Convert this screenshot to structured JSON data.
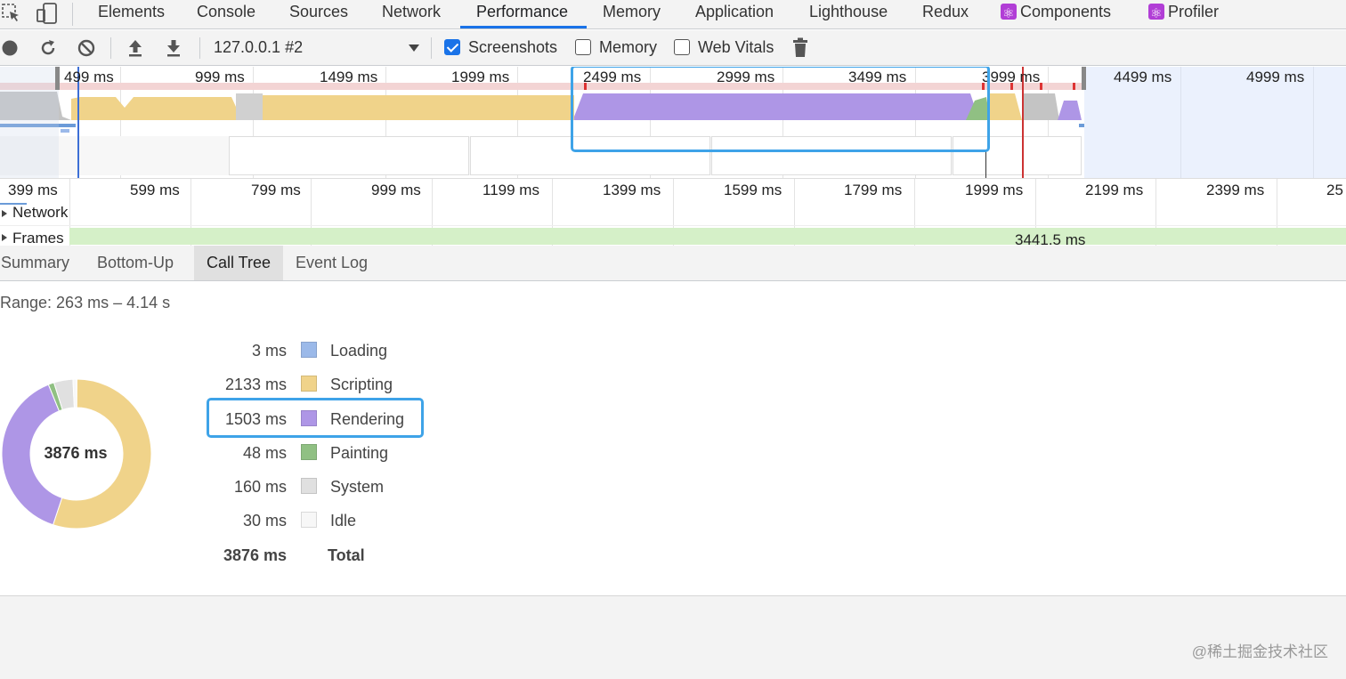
{
  "devtools": {
    "tabs": [
      {
        "label": "Elements"
      },
      {
        "label": "Console"
      },
      {
        "label": "Sources"
      },
      {
        "label": "Network"
      },
      {
        "label": "Performance"
      },
      {
        "label": "Memory"
      },
      {
        "label": "Application"
      },
      {
        "label": "Lighthouse"
      },
      {
        "label": "Redux"
      },
      {
        "label": "Components"
      },
      {
        "label": "Profiler"
      }
    ],
    "active_tab": "Performance"
  },
  "toolbar": {
    "profile_select": "127.0.0.1 #2",
    "screenshots_label": "Screenshots",
    "screenshots_checked": true,
    "memory_label": "Memory",
    "memory_checked": false,
    "web_vitals_label": "Web Vitals",
    "web_vitals_checked": false
  },
  "overview": {
    "ticks": [
      "499 ms",
      "999 ms",
      "1499 ms",
      "1999 ms",
      "2499 ms",
      "2999 ms",
      "3499 ms",
      "3999 ms",
      "4499 ms",
      "4999 ms"
    ]
  },
  "timeline": {
    "ticks": [
      "399 ms",
      "599 ms",
      "799 ms",
      "999 ms",
      "1199 ms",
      "1399 ms",
      "1599 ms",
      "1799 ms",
      "1999 ms",
      "2199 ms",
      "2399 ms",
      "25"
    ],
    "tracks": {
      "network_label": "Network",
      "frames_label": "Frames",
      "frames_value": "3441.5 ms"
    }
  },
  "details": {
    "tabs": [
      {
        "label": "Summary"
      },
      {
        "label": "Bottom-Up"
      },
      {
        "label": "Call Tree"
      },
      {
        "label": "Event Log"
      }
    ],
    "selected_tab": "Call Tree",
    "range": "Range: 263 ms – 4.14 s",
    "donut_total": "3876 ms",
    "categories": [
      {
        "value": "3 ms",
        "name": "Loading",
        "color": "#9bb9e9",
        "ms": 3
      },
      {
        "value": "2133 ms",
        "name": "Scripting",
        "color": "#f0d38a",
        "ms": 2133
      },
      {
        "value": "1503 ms",
        "name": "Rendering",
        "color": "#ae96e6",
        "ms": 1503
      },
      {
        "value": "48 ms",
        "name": "Painting",
        "color": "#90c083",
        "ms": 48
      },
      {
        "value": "160 ms",
        "name": "System",
        "color": "#e0e0e0",
        "ms": 160
      },
      {
        "value": "30 ms",
        "name": "Idle",
        "color": "#f7f7f7",
        "ms": 30
      }
    ],
    "total": {
      "value": "3876 ms",
      "name": "Total"
    }
  },
  "colors": {
    "highlight": "#3ea3e8",
    "scripting": "#f0d38a",
    "rendering": "#ae96e6",
    "painting": "#90c083",
    "system": "#d0d0d0",
    "frames": "#d5f0c8"
  },
  "watermark": "@稀土掘金技术社区"
}
